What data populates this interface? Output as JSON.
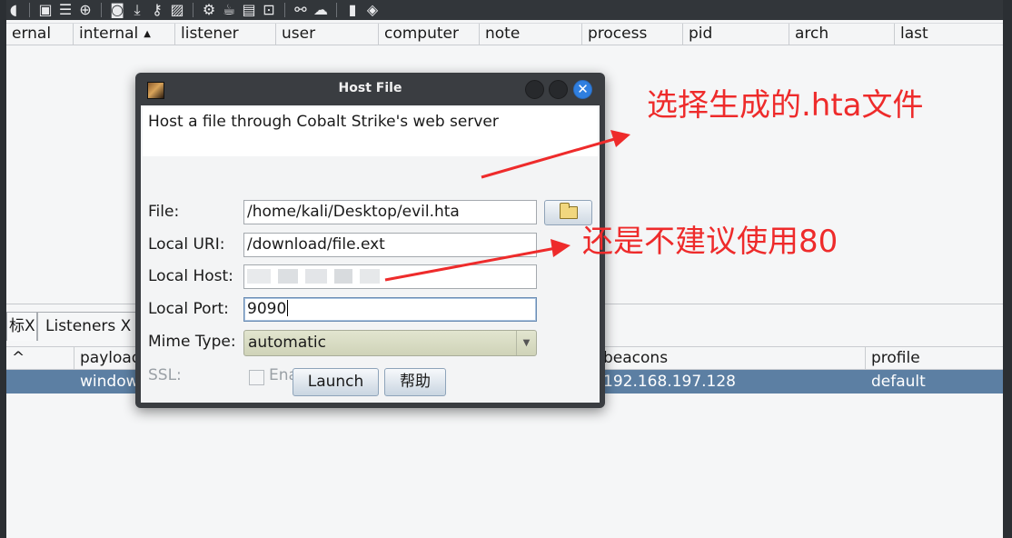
{
  "toolbar": {
    "icons": [
      "headphones-icon",
      "network-icon",
      "list-icon",
      "target-icon",
      "screenshot-icon",
      "download-icon",
      "key-icon",
      "image-icon",
      "settings-icon",
      "coffee-icon",
      "document-icon",
      "terminal-icon",
      "link-icon",
      "cloud-icon",
      "book-icon",
      "cube-icon"
    ]
  },
  "top_table": {
    "columns": [
      "ernal",
      "internal",
      "listener",
      "user",
      "computer",
      "note",
      "process",
      "pid",
      "arch",
      "last"
    ],
    "sort_indicator": "▲"
  },
  "dialog": {
    "title": "Host File",
    "description": "Host a file through Cobalt Strike's web server",
    "fields": {
      "file_label": "File:",
      "file_value": "/home/kali/Desktop/evil.hta",
      "uri_label": "Local URI:",
      "uri_value": "/download/file.ext",
      "host_label": "Local Host:",
      "host_value": "",
      "port_label": "Local Port:",
      "port_value": "9090",
      "mime_label": "Mime Type:",
      "mime_value": "automatic",
      "ssl_label": "SSL:",
      "ssl_checkbox_label": "Enable SSL"
    },
    "buttons": {
      "launch": "Launch",
      "help": "帮助"
    }
  },
  "bottom": {
    "tabs": [
      "标X",
      "Listeners X"
    ],
    "columns": [
      "^",
      "payload",
      "beacons",
      "profile"
    ],
    "row": [
      "window",
      "192.168.197.128",
      "default"
    ]
  },
  "annotations": {
    "file_note": "选择生成的.hta文件",
    "port_note": "还是不建议使用80",
    "color": "#ee2b2b"
  }
}
